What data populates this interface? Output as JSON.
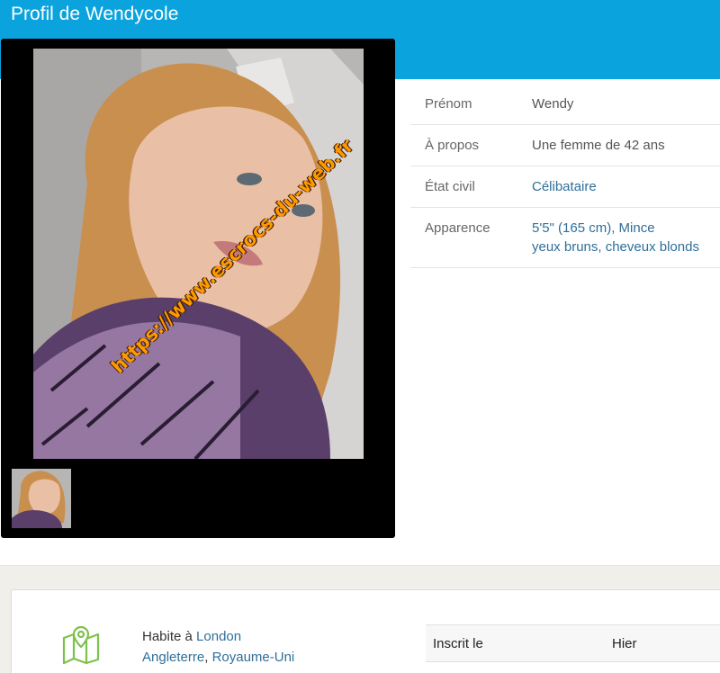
{
  "header": {
    "title": "Profil de Wendycole"
  },
  "gallery": {
    "watermark": "https://www.escrocs-du-web.fr"
  },
  "profile": {
    "firstname_label": "Prénom",
    "firstname_value": "Wendy",
    "about_label": "À propos",
    "about_value": "Une femme de 42 ans",
    "status_label": "État civil",
    "status_value": "Célibataire",
    "appearance_label": "Apparence",
    "appearance_line1": "5'5\" (165 cm), Mince",
    "appearance_line2": "yeux bruns, cheveux blonds"
  },
  "location": {
    "lives_prefix": "Habite à",
    "city": "London",
    "region": "Angleterre",
    "separator": ",",
    "country": "Royaume-Uni"
  },
  "registration": {
    "label": "Inscrit le",
    "value": "Hier"
  },
  "icons": {
    "map": "map-pin-icon"
  },
  "colors": {
    "header": "#0aa3dd",
    "link": "#2f6f98",
    "watermark": "#ff9900",
    "map_icon": "#7cc24a"
  }
}
